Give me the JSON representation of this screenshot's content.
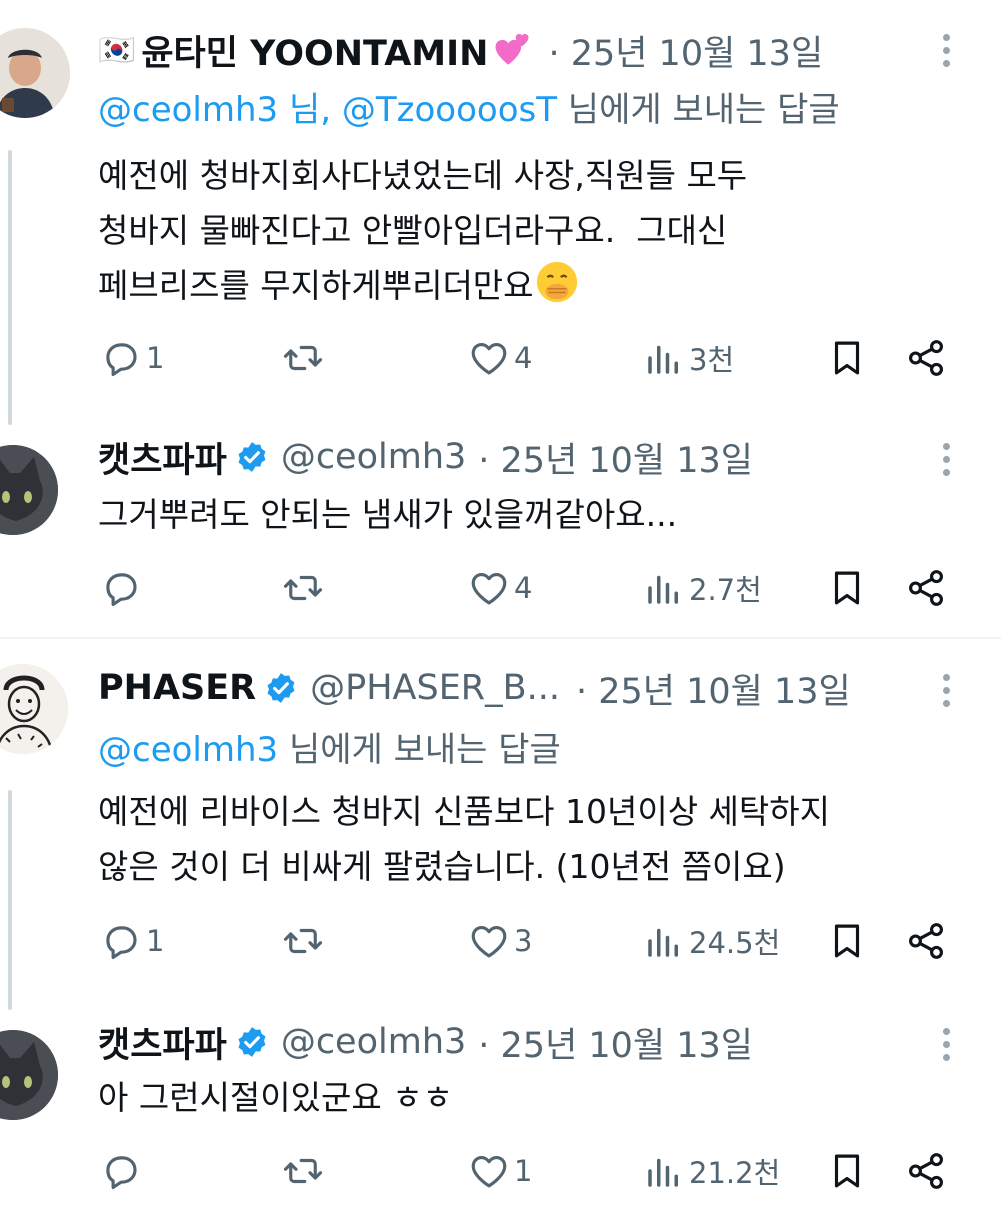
{
  "tweets": [
    {
      "flag": "🇰🇷",
      "name": "윤타민 YOONTAMIN",
      "heart_emoji": "💕",
      "handle": "",
      "date": "· 25년 10월 13일",
      "reply_to": {
        "m1": "@ceolmh3",
        "sep": " 님, ",
        "m2": "@TzooooosT",
        "suffix": " 님에게 보내는 답글"
      },
      "text": "예전에 청바지회사다녔었는데 사장,직원들 모두\n청바지 물빠진다고 안빨아입더라구요.  그대신\n페브리즈를 무지하게뿌리더만요",
      "text_emoji": "🤭",
      "stats": {
        "replies": "1",
        "retweets": "",
        "likes": "4",
        "views": "3천"
      }
    },
    {
      "name": "캣츠파파",
      "handle": "@ceolmh3",
      "date": "· 25년 10월 13일",
      "text": "그거뿌려도 안되는 냄새가 있을꺼같아요...",
      "stats": {
        "replies": "",
        "retweets": "",
        "likes": "4",
        "views": "2.7천"
      }
    },
    {
      "name": "PHASER",
      "handle": "@PHASER_B...",
      "date": "· 25년 10월 13일",
      "reply_to": {
        "m1": "@ceolmh3",
        "suffix": " 님에게 보내는 답글"
      },
      "text": "예전에 리바이스 청바지 신품보다 10년이상 세탁하지\n않은 것이 더 비싸게 팔렸습니다. (10년전 쯤이요)",
      "stats": {
        "replies": "1",
        "retweets": "",
        "likes": "3",
        "views": "24.5천"
      }
    },
    {
      "name": "캣츠파파",
      "handle": "@ceolmh3",
      "date": "· 25년 10월 13일",
      "text": "아 그런시절이있군요 ㅎㅎ",
      "stats": {
        "replies": "",
        "retweets": "",
        "likes": "1",
        "views": "21.2천"
      }
    }
  ],
  "icons": {
    "reply": "reply-icon",
    "retweet": "retweet-icon",
    "like": "heart-icon",
    "views": "views-chart-icon",
    "bookmark": "bookmark-icon",
    "share": "share-icon",
    "verified": "verified-badge-icon",
    "more": "more-dots-icon"
  },
  "colors": {
    "accent": "#1d9bf0",
    "text": "#0f1419",
    "muted": "#536471",
    "verified": "#1d9bf0"
  }
}
